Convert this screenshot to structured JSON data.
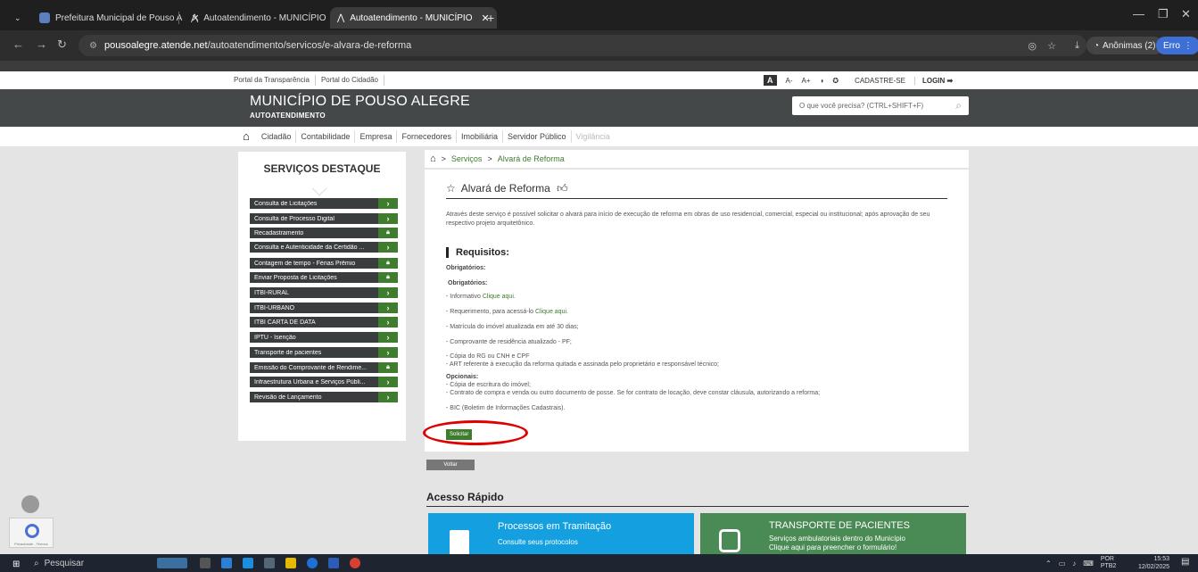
{
  "browser": {
    "tabs": [
      {
        "label": "Prefeitura Municipal de Pouso A",
        "close": "✕"
      },
      {
        "label": "Autoatendimento - MUNICÍPIO",
        "close": "✕"
      },
      {
        "label": "Autoatendimento - MUNICÍPIO",
        "close": "✕"
      }
    ],
    "new_tab": "+",
    "url_host": "pousoalegre.atende.net",
    "url_path": "/autoatendimento/servicos/e-alvara-de-reforma",
    "incognito_label": "Anônimas (2)",
    "error_label": "Erro"
  },
  "site": {
    "top_links": [
      "Portal da Transparência",
      "Portal do Cidadão"
    ],
    "font_tools": [
      "A",
      "A-",
      "A+"
    ],
    "register": "CADASTRE-SE",
    "login": "LOGIN",
    "brand": "MUNICÍPIO DE POUSO ALEGRE",
    "subbrand": "AUTOATENDIMENTO",
    "search_placeholder": "O que você precisa? (CTRL+SHIFT+F)",
    "menu": [
      "Cidadão",
      "Contabilidade",
      "Empresa",
      "Fornecedores",
      "Imobiliária",
      "Servidor Público",
      "Vigilância"
    ]
  },
  "sidebar": {
    "title": "SERVIÇOS DESTAQUE",
    "items": [
      {
        "label": "Consulta de Licitações",
        "action": "›"
      },
      {
        "label": "Consulta de Processo Digital",
        "action": "›"
      },
      {
        "label": "Recadastramento",
        "action": "lock"
      },
      {
        "label": "Consulta e Autenticidade da Certidão ...",
        "action": "›"
      },
      {
        "label": "Contagem de tempo - Férias Prêmio",
        "action": "lock"
      },
      {
        "label": "Enviar Proposta de Licitações",
        "action": "lock"
      },
      {
        "label": "ITBI-RURAL",
        "action": "›"
      },
      {
        "label": "ITBI-URBANO",
        "action": "›"
      },
      {
        "label": "ITBI CARTA DE DATA",
        "action": "›"
      },
      {
        "label": "IPTU - Isenção",
        "action": "›"
      },
      {
        "label": "Transporte de pacientes",
        "action": "›"
      },
      {
        "label": "Emissão do Comprovante de Rendime...",
        "action": "lock"
      },
      {
        "label": "Infraestrutura Urbana e Serviços Públi...",
        "action": "›"
      },
      {
        "label": "Revisão de Lançamento",
        "action": "›"
      }
    ]
  },
  "breadcrumb": {
    "sep": ">",
    "items": [
      "Serviços",
      "Alvará de Reforma"
    ]
  },
  "page": {
    "title": "Alvará de Reforma",
    "description": "Através deste serviço é possível solicitar o alvará para início de execução de reforma em obras de uso residencial, comercial, especial ou institucional; após aprovação de seu respectivo projeto arquitetônico.",
    "requirements_heading": "Requisitos:",
    "obrigatorios_1": "Obrigatórios:",
    "obrigatorios_2": "Obrigatórios:",
    "req_informativo": "- Informativo ",
    "req_informativo_link": "Clique aqui.",
    "req_requerimento": "- Requerimento, para acessá-lo ",
    "req_requerimento_link": "Clique aqui.",
    "req_matricula": "- Matrícula do imóvel atualizada em até 30 dias;",
    "req_comprovante": "- Comprovante de residência atualizado - PF;",
    "req_rg": "- Cópia do RG ou CNH e CPF",
    "req_art": "- ART referente à execução da reforma quitada e assinada pelo proprietário e responsável técnico;",
    "opcionais": "Opcionais:",
    "opt_escritura": "- Cópia de escritura do imóvel;",
    "opt_contrato": "- Contrato de compra e venda ou outro documento de posse. Se for contrato de locação, deve constar cláusula, autorizando a reforma;",
    "opt_bic": "- BIC (Boletim de Informações Cadastrais).",
    "solicitar": "Solicitar",
    "voltar": "Voltar"
  },
  "quick_access": {
    "title": "Acesso Rápido",
    "cards": [
      {
        "title": "Processos em Tramitação",
        "subtitle": "Consulte seus protocolos",
        "color": "#14a0e0"
      },
      {
        "title": "TRANSPORTE DE PACIENTES",
        "subtitle": "Serviços ambulatoriais dentro do Município",
        "subtitle2": "Clique aqui para preencher o formulário!",
        "color": "#4a8a54"
      }
    ]
  },
  "captcha_label": "Privacidade - Termos",
  "taskbar": {
    "search": "Pesquisar",
    "lang": "POR",
    "lang2": "PTB2",
    "time": "15:53",
    "date": "12/02/2025"
  },
  "colors": {
    "accent_green": "#3e7c2e",
    "header_dark": "#444849",
    "annotation_red": "#e00000"
  }
}
